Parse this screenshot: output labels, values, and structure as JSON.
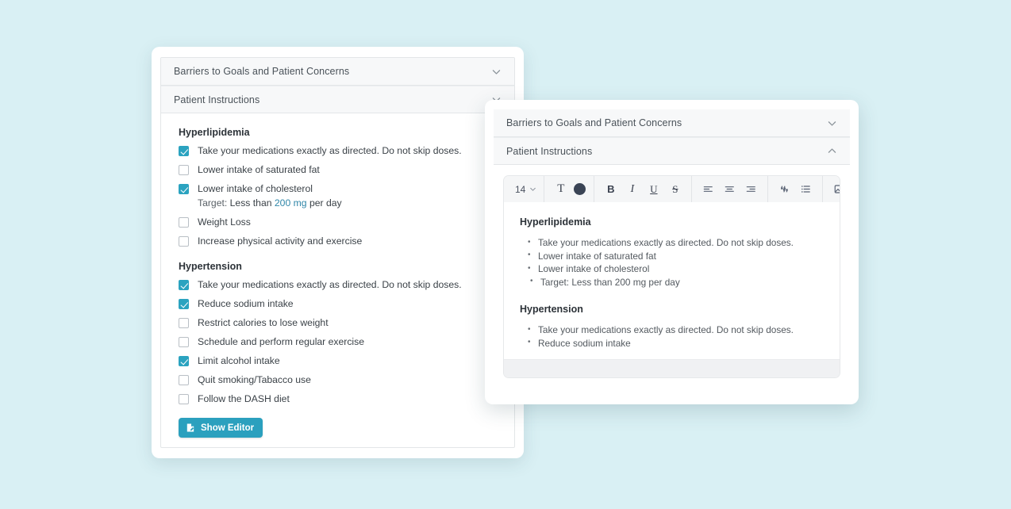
{
  "theme": {
    "page_bg": "#d9f0f4",
    "accent_teal": "#2ba0be",
    "checkbox_on": "#2ba3c0",
    "link_accent": "#2f86a8",
    "color_swatch": "#3a4455"
  },
  "base_panel": {
    "accordions": [
      {
        "label": "Barriers to Goals and Patient Concerns",
        "icon": "chevron-down-icon",
        "expanded": false
      },
      {
        "label": "Patient Instructions",
        "icon": "chevron-down-icon",
        "expanded": true
      }
    ],
    "groups": [
      {
        "title": "Hyperlipidemia",
        "items": [
          {
            "label": "Take your medications exactly as directed. Do not skip doses.",
            "checked": true
          },
          {
            "label": "Lower intake of saturated fat",
            "checked": false
          },
          {
            "label": "Lower intake of cholesterol",
            "checked": true,
            "sub_target": {
              "prefix": "Target:",
              "strong": "Less than",
              "accent": "200 mg",
              "suffix": "per day"
            }
          },
          {
            "label": "Weight Loss",
            "checked": false
          },
          {
            "label": "Increase physical activity and exercise",
            "checked": false
          }
        ]
      },
      {
        "title": "Hypertension",
        "items": [
          {
            "label": "Take your medications exactly as directed. Do not skip doses.",
            "checked": true
          },
          {
            "label": "Reduce sodium intake",
            "checked": true
          },
          {
            "label": "Restrict calories to lose weight",
            "checked": false
          },
          {
            "label": "Schedule and perform regular exercise",
            "checked": false
          },
          {
            "label": "Limit alcohol intake",
            "checked": true
          },
          {
            "label": "Quit smoking/Tabacco use",
            "checked": false
          },
          {
            "label": "Follow the DASH diet",
            "checked": false
          }
        ]
      }
    ],
    "show_editor_button": {
      "label": "Show Editor",
      "icon": "file-document-icon"
    }
  },
  "popup_panel": {
    "accordions": [
      {
        "label": "Barriers to Goals and Patient Concerns",
        "icon": "chevron-down-icon",
        "expanded": false
      },
      {
        "label": "Patient Instructions",
        "icon": "chevron-up-icon",
        "expanded": true
      }
    ],
    "editor": {
      "toolbar": {
        "font_size": "14",
        "font_size_icon": "chevron-down-icon",
        "buttons": [
          {
            "name": "text-format-icon",
            "glyph": "T"
          },
          {
            "name": "text-color-swatch",
            "glyph": ""
          },
          {
            "name": "bold-icon",
            "glyph": "B"
          },
          {
            "name": "italic-icon",
            "glyph": "I"
          },
          {
            "name": "underline-icon",
            "glyph": "U"
          },
          {
            "name": "strikethrough-icon",
            "glyph": "S"
          },
          {
            "name": "align-left-icon",
            "glyph": ""
          },
          {
            "name": "align-center-icon",
            "glyph": ""
          },
          {
            "name": "align-right-icon",
            "glyph": ""
          },
          {
            "name": "blockquote-icon",
            "glyph": ""
          },
          {
            "name": "bulleted-list-icon",
            "glyph": ""
          },
          {
            "name": "insert-image-icon",
            "glyph": ""
          },
          {
            "name": "insert-link-icon",
            "glyph": ""
          }
        ]
      },
      "content": {
        "sections": [
          {
            "heading": "Hyperlipidemia",
            "bullets": [
              {
                "text": "Take your medications exactly as directed. Do not skip doses.",
                "level": 1
              },
              {
                "text": "Lower intake of saturated fat",
                "level": 1
              },
              {
                "text": "Lower intake of cholesterol",
                "level": 1
              },
              {
                "text": "Target: Less than 200 mg per day",
                "level": 2
              }
            ]
          },
          {
            "heading": "Hypertension",
            "bullets": [
              {
                "text": "Take your medications exactly as directed. Do not skip doses.",
                "level": 1
              },
              {
                "text": "Reduce sodium intake",
                "level": 1
              }
            ]
          }
        ]
      }
    }
  }
}
